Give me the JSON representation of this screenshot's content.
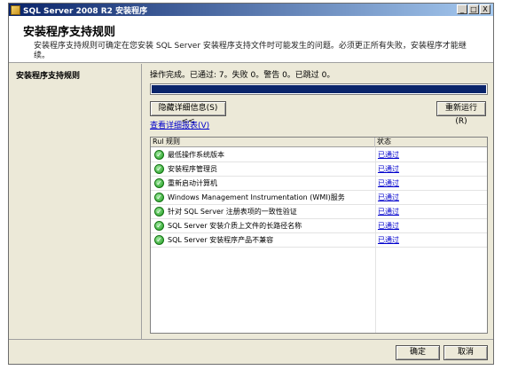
{
  "window": {
    "title": "SQL Server 2008 R2 安装程序",
    "controls": {
      "minimize": "_",
      "maximize": "□",
      "close": "X"
    }
  },
  "header": {
    "title": "安装程序支持规则",
    "description": "安装程序支持规则可确定在您安装 SQL Server 安装程序支持文件时可能发生的问题。必须更正所有失败，安装程序才能继续。"
  },
  "left_pane": {
    "items": [
      "安装程序支持规则"
    ]
  },
  "content": {
    "status_text": "操作完成。已通过: 7。失败 0。警告 0。已跳过 0。",
    "progress_percent": 100,
    "hide_details_label": "隐藏详细信息(S) <<",
    "rerun_label": "重新运行(R)",
    "report_link": "查看详细报表(V)"
  },
  "table": {
    "columns": [
      "Rul 规则",
      "状态"
    ],
    "rows": [
      {
        "rule": "最低操作系统版本",
        "status": "已通过"
      },
      {
        "rule": "安装程序管理员",
        "status": "已通过"
      },
      {
        "rule": "重新启动计算机",
        "status": "已通过"
      },
      {
        "rule": "Windows Management Instrumentation (WMI)服务",
        "status": "已通过"
      },
      {
        "rule": "针对 SQL Server 注册表项的一致性验证",
        "status": "已通过"
      },
      {
        "rule": "SQL Server 安装介质上文件的长路径名称",
        "status": "已通过"
      },
      {
        "rule": "SQL Server 安装程序产品不兼容",
        "status": "已通过"
      }
    ]
  },
  "footer": {
    "ok_label": "确定",
    "cancel_label": "取消"
  }
}
